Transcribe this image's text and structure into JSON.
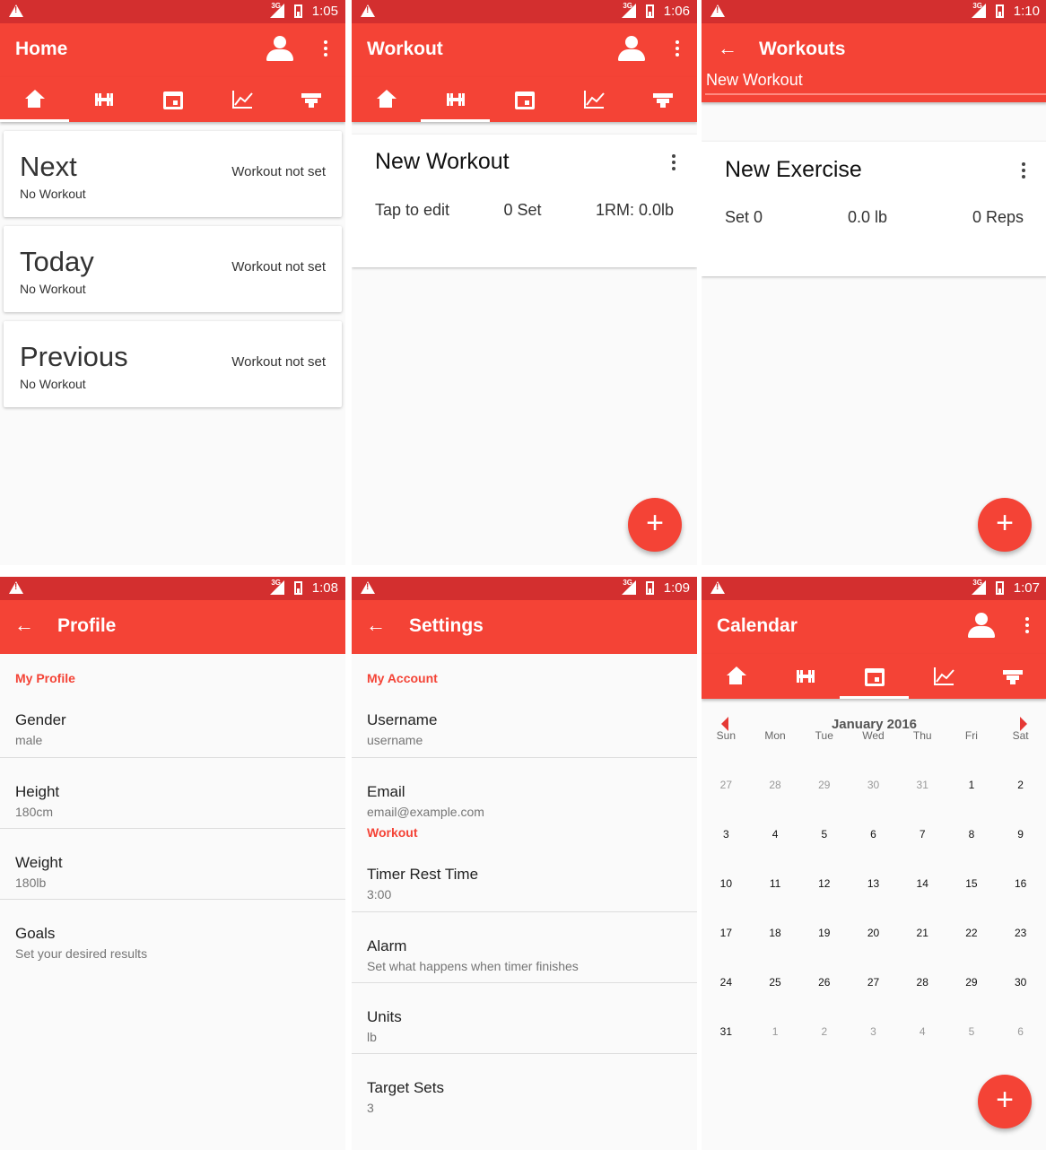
{
  "status": {
    "t1": "1:05",
    "t2": "1:06",
    "t3": "1:10",
    "t4": "1:08",
    "t5": "1:09",
    "t6": "1:07",
    "net": "3G"
  },
  "colors": {
    "primary": "#f44336",
    "primary_dark": "#d32f2f",
    "accent": "#f44336"
  },
  "tab_icons": [
    "home-icon",
    "dumbbell-icon",
    "calendar-icon",
    "chart-icon",
    "podium-icon"
  ],
  "home": {
    "title": "Home",
    "cards": [
      {
        "title": "Next",
        "sub": "No Workout",
        "status": "Workout not set"
      },
      {
        "title": "Today",
        "sub": "No Workout",
        "status": "Workout not set"
      },
      {
        "title": "Previous",
        "sub": "No Workout",
        "status": "Workout not set"
      }
    ]
  },
  "workout": {
    "title": "Workout",
    "name": "New Workout",
    "edit": "Tap to edit",
    "sets": "0 Set",
    "orm": "1RM: 0.0lb",
    "fab": "+"
  },
  "workouts": {
    "title": "Workouts",
    "input": "New Workout",
    "exercise": "New Exercise",
    "set": "Set 0",
    "weight": "0.0 lb",
    "reps": "0 Reps",
    "fab": "+"
  },
  "profile": {
    "title": "Profile",
    "category": "My Profile",
    "items": [
      {
        "title": "Gender",
        "value": "male"
      },
      {
        "title": "Height",
        "value": "180cm"
      },
      {
        "title": "Weight",
        "value": "180lb"
      },
      {
        "title": "Goals",
        "value": "Set your desired results"
      }
    ]
  },
  "settings": {
    "title": "Settings",
    "cat_account": "My Account",
    "account": [
      {
        "title": "Username",
        "value": "username"
      },
      {
        "title": "Email",
        "value": "email@example.com"
      }
    ],
    "cat_workout": "Workout",
    "workout": [
      {
        "title": "Timer Rest Time",
        "value": "3:00"
      },
      {
        "title": "Alarm",
        "value": "Set what happens when timer finishes"
      },
      {
        "title": "Units",
        "value": "lb"
      },
      {
        "title": "Target Sets",
        "value": "3"
      }
    ]
  },
  "calendar": {
    "title": "Calendar",
    "month": "January 2016",
    "days_of_week": [
      "Sun",
      "Mon",
      "Tue",
      "Wed",
      "Thu",
      "Fri",
      "Sat"
    ],
    "days": [
      [
        "27",
        "28",
        "29",
        "30",
        "31",
        "1",
        "2"
      ],
      [
        "3",
        "4",
        "5",
        "6",
        "7",
        "8",
        "9"
      ],
      [
        "10",
        "11",
        "12",
        "13",
        "14",
        "15",
        "16"
      ],
      [
        "17",
        "18",
        "19",
        "20",
        "21",
        "22",
        "23"
      ],
      [
        "24",
        "25",
        "26",
        "27",
        "28",
        "29",
        "30"
      ],
      [
        "31",
        "1",
        "2",
        "3",
        "4",
        "5",
        "6"
      ]
    ],
    "fab": "+"
  }
}
